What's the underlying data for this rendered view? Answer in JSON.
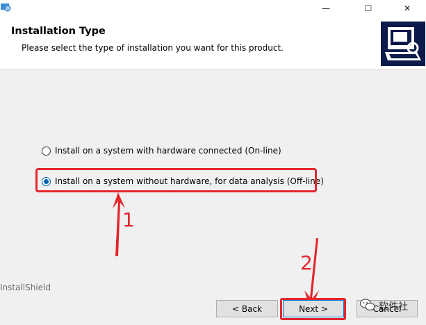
{
  "window": {
    "minimize_glyph": "—",
    "maximize_glyph": "☐",
    "close_glyph": "✕"
  },
  "header": {
    "title": "Installation Type",
    "subtitle": "Please select the type of installation you want for this product."
  },
  "options": [
    {
      "label": "Install on a system with hardware connected (On-line)",
      "selected": false
    },
    {
      "label": "Install on a system without hardware, for data analysis (Off-line)",
      "selected": true
    }
  ],
  "annotations": {
    "step1": "1",
    "step2": "2"
  },
  "footer": {
    "brand": "InstallShield",
    "back_label": "< Back",
    "next_label": "Next >",
    "cancel_label": "Cancel"
  },
  "watermark": {
    "text": "软件社"
  },
  "colors": {
    "annotation": "#e3262b",
    "accent": "#0063b1"
  }
}
